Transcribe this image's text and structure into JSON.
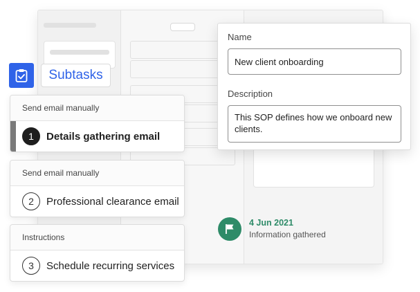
{
  "subtasks": {
    "label": "Subtasks",
    "icon": "clipboard-check-icon"
  },
  "tasks": [
    {
      "section": "Send email manually",
      "number": "1",
      "title": "Details gathering email",
      "active": true
    },
    {
      "section": "Send email manually",
      "number": "2",
      "title": "Professional clearance email",
      "active": false
    },
    {
      "section": "Instructions",
      "number": "3",
      "title": "Schedule recurring services",
      "active": false
    }
  ],
  "form": {
    "name_label": "Name",
    "name_value": "New client onboarding",
    "description_label": "Description",
    "description_value": "This SOP defines how we onboard new clients."
  },
  "milestone": {
    "date": "4 Jun 2021",
    "status": "Information gathered",
    "icon": "flag-icon"
  },
  "colors": {
    "accent_blue": "#2f63e8",
    "success_green": "#2e8b68",
    "active_dark": "#1e1e1e"
  }
}
